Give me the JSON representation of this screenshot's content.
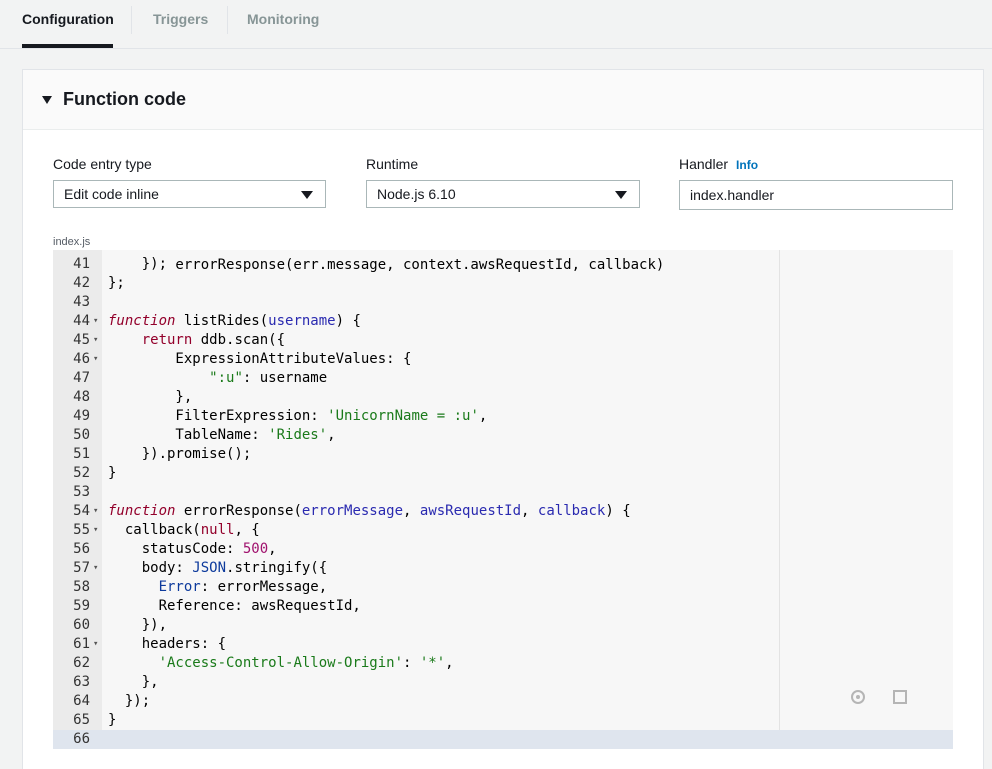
{
  "tabs": [
    {
      "label": "Configuration",
      "active": true
    },
    {
      "label": "Triggers",
      "active": false
    },
    {
      "label": "Monitoring",
      "active": false
    }
  ],
  "section": {
    "title": "Function code"
  },
  "fields": {
    "code_entry_type": {
      "label": "Code entry type",
      "value": "Edit code inline"
    },
    "runtime": {
      "label": "Runtime",
      "value": "Node.js 6.10"
    },
    "handler": {
      "label": "Handler",
      "info_link": "Info",
      "value": "index.handler"
    }
  },
  "editor": {
    "file_tab": "index.js",
    "partial_line_top": "        errorResponse(err.message, context.awsRequestId, callback)",
    "lines": [
      {
        "n": "41",
        "fold": false,
        "html": "    });"
      },
      {
        "n": "42",
        "fold": false,
        "html": "};"
      },
      {
        "n": "43",
        "fold": false,
        "html": ""
      },
      {
        "n": "44",
        "fold": true,
        "html": "<span class=\"kw\">function</span> listRides(<span class=\"par\">username</span>) {"
      },
      {
        "n": "45",
        "fold": true,
        "html": "    <span class=\"ret\">return</span> ddb.scan({"
      },
      {
        "n": "46",
        "fold": true,
        "html": "        ExpressionAttributeValues: {"
      },
      {
        "n": "47",
        "fold": false,
        "html": "            <span class=\"str\">\":u\"</span>: username"
      },
      {
        "n": "48",
        "fold": false,
        "html": "        },"
      },
      {
        "n": "49",
        "fold": false,
        "html": "        FilterExpression: <span class=\"str\">'UnicornName = :u'</span>,"
      },
      {
        "n": "50",
        "fold": false,
        "html": "        TableName: <span class=\"str\">'Rides'</span>,"
      },
      {
        "n": "51",
        "fold": false,
        "html": "    }).promise();"
      },
      {
        "n": "52",
        "fold": false,
        "html": "}"
      },
      {
        "n": "53",
        "fold": false,
        "html": ""
      },
      {
        "n": "54",
        "fold": true,
        "html": "<span class=\"kw\">function</span> errorResponse(<span class=\"par\">errorMessage</span>, <span class=\"par\">awsRequestId</span>, <span class=\"par\">callback</span>) {"
      },
      {
        "n": "55",
        "fold": true,
        "html": "  callback(<span class=\"ret\">null</span>, {"
      },
      {
        "n": "56",
        "fold": false,
        "html": "    statusCode: <span class=\"num\">500</span>,"
      },
      {
        "n": "57",
        "fold": true,
        "html": "    body: <span class=\"prop\">JSON</span>.stringify({"
      },
      {
        "n": "58",
        "fold": false,
        "html": "      <span class=\"prop\">Error</span>: errorMessage,"
      },
      {
        "n": "59",
        "fold": false,
        "html": "      Reference: awsRequestId,"
      },
      {
        "n": "60",
        "fold": false,
        "html": "    }),"
      },
      {
        "n": "61",
        "fold": true,
        "html": "    headers: {"
      },
      {
        "n": "62",
        "fold": false,
        "html": "      <span class=\"str\">'Access-Control-Allow-Origin'</span>: <span class=\"str\">'*'</span>,"
      },
      {
        "n": "63",
        "fold": false,
        "html": "    },"
      },
      {
        "n": "64",
        "fold": false,
        "html": "  });"
      },
      {
        "n": "65",
        "fold": false,
        "html": "}"
      },
      {
        "n": "66",
        "fold": false,
        "html": "",
        "current": true
      }
    ]
  },
  "icons": {
    "settings": "gear-icon",
    "fullscreen": "expand-icon"
  }
}
